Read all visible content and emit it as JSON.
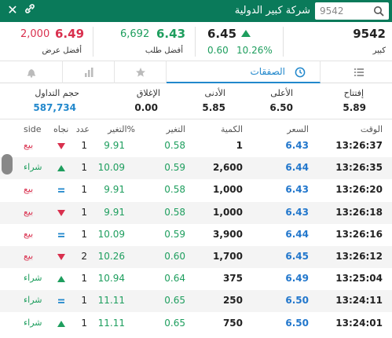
{
  "header": {
    "title": "شركة كبير الدولية",
    "search_value": "9542",
    "close_icon": "close-icon",
    "link_icon": "link-icon"
  },
  "quote": {
    "symbol": "9542",
    "symbol_label": "كبير",
    "price": "6.45",
    "change": "0.60",
    "change_pct": "10.26%",
    "bid_qty": "6,692",
    "bid_price": "6.43",
    "bid_label": "أفضل طلب",
    "ask_qty": "2,000",
    "ask_price": "6.49",
    "ask_label": "أفضل عرض"
  },
  "tabs": [
    {
      "name": "list",
      "icon": "list-icon"
    },
    {
      "name": "trades",
      "label": "الصفقات",
      "icon": "clock-icon",
      "active": true
    },
    {
      "name": "favorite",
      "icon": "star-icon"
    },
    {
      "name": "chart",
      "icon": "bar-chart-icon"
    },
    {
      "name": "alerts",
      "icon": "bell-icon"
    }
  ],
  "stats": [
    {
      "label": "إفتتاح",
      "value": "5.89"
    },
    {
      "label": "الأعلى",
      "value": "6.50"
    },
    {
      "label": "الأدنى",
      "value": "5.85"
    },
    {
      "label": "الإغلاق",
      "value": "0.00"
    },
    {
      "label": "حجم التداول",
      "value": "587,734"
    }
  ],
  "table": {
    "headers": {
      "time": "الوقت",
      "price": "السعر",
      "qty": "الكمية",
      "change": "التغير",
      "change_pct": "التغير%",
      "count": "عدد",
      "direction": "نجاه",
      "side": "side"
    },
    "rows": [
      {
        "time": "13:26:37",
        "price": "6.43",
        "qty": "1",
        "change": "0.58",
        "pct": "9.91",
        "count": "1",
        "dir": "down",
        "side": "بيع"
      },
      {
        "time": "13:26:35",
        "price": "6.44",
        "qty": "2,600",
        "change": "0.59",
        "pct": "10.09",
        "count": "1",
        "dir": "up",
        "side": "شراء"
      },
      {
        "time": "13:26:20",
        "price": "6.43",
        "qty": "1,000",
        "change": "0.58",
        "pct": "9.91",
        "count": "1",
        "dir": "equal",
        "side": "بيع"
      },
      {
        "time": "13:26:18",
        "price": "6.43",
        "qty": "1,000",
        "change": "0.58",
        "pct": "9.91",
        "count": "1",
        "dir": "down",
        "side": "بيع"
      },
      {
        "time": "13:26:16",
        "price": "6.44",
        "qty": "3,900",
        "change": "0.59",
        "pct": "10.09",
        "count": "1",
        "dir": "equal",
        "side": "بيع"
      },
      {
        "time": "13:26:12",
        "price": "6.45",
        "qty": "1,700",
        "change": "0.60",
        "pct": "10.26",
        "count": "2",
        "dir": "down",
        "side": "بيع"
      },
      {
        "time": "13:25:04",
        "price": "6.49",
        "qty": "375",
        "change": "0.64",
        "pct": "10.94",
        "count": "1",
        "dir": "up",
        "side": "شراء"
      },
      {
        "time": "13:24:11",
        "price": "6.50",
        "qty": "250",
        "change": "0.65",
        "pct": "11.11",
        "count": "1",
        "dir": "equal",
        "side": "شراء"
      },
      {
        "time": "13:24:01",
        "price": "6.50",
        "qty": "750",
        "change": "0.65",
        "pct": "11.11",
        "count": "1",
        "dir": "up",
        "side": "شراء"
      }
    ]
  },
  "colors": {
    "header_bg": "#0a7a5a",
    "accent_blue": "#2288cc",
    "up_green": "#1e9e5e",
    "down_red": "#d9304e"
  }
}
